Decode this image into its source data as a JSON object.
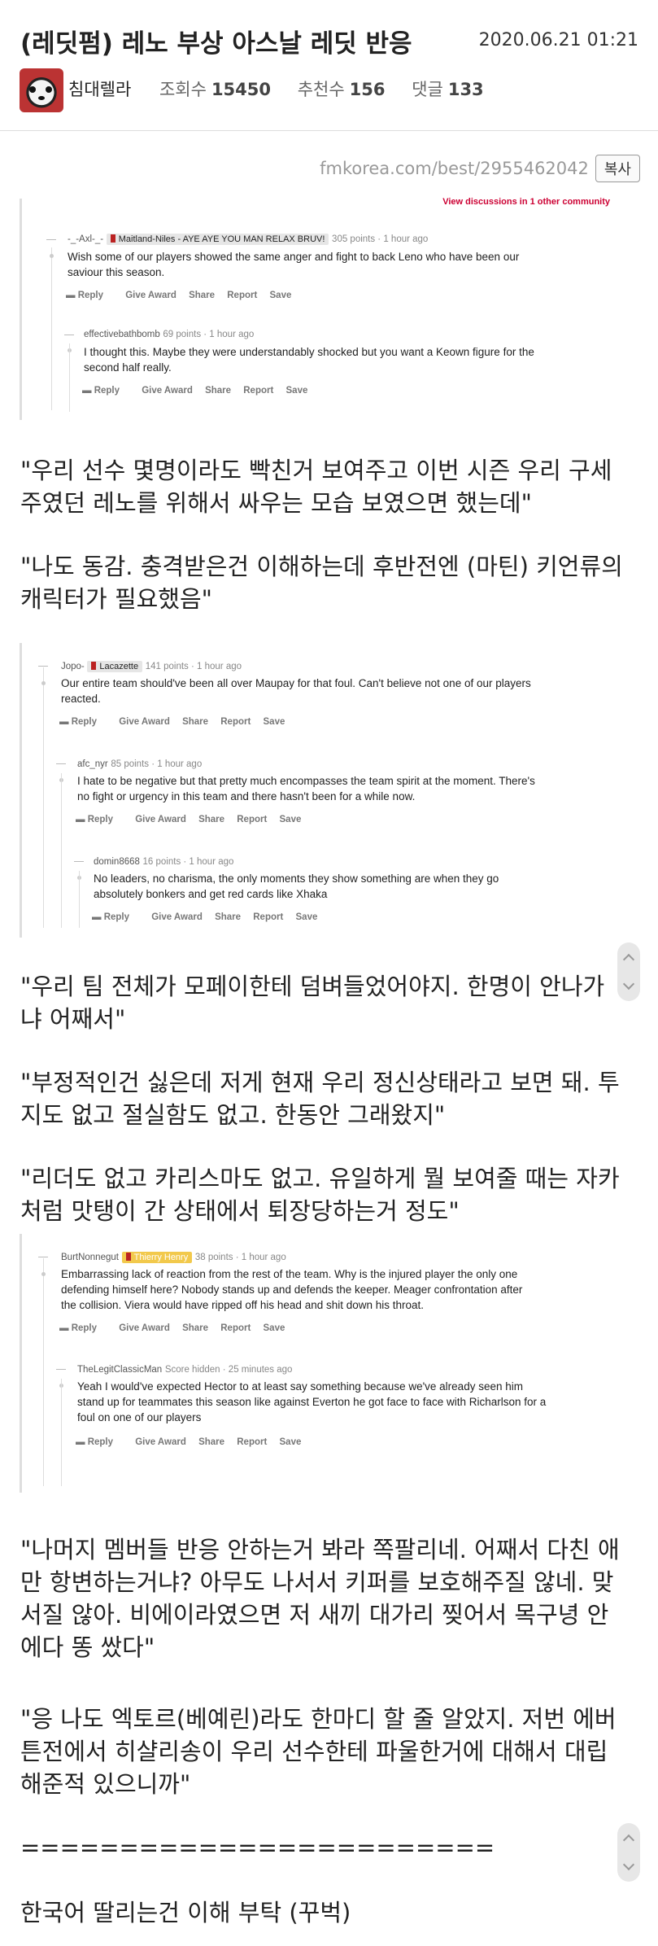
{
  "header": {
    "title": "(레딧펌) 레노 부상 아스날 레딧 반응",
    "date": "2020.06.21 01:21",
    "author": "침대렐라",
    "views_label": "조회수",
    "views": "15450",
    "likes_label": "추천수",
    "likes": "156",
    "comments_label": "댓글",
    "comments": "133"
  },
  "urlbar": {
    "url": "fmkorea.com/best/2955462042",
    "copy_label": "복사"
  },
  "shots": [
    {
      "top_cut": "View discussions in 1 other community",
      "comments": [
        {
          "user": "-_-Axl-_-",
          "flair": "Maitland-Niles - AYE AYE YOU MAN RELAX BRUV!",
          "points": "305 points · 1 hour ago",
          "lines": [
            "Wish some of our players showed the same anger and fight to back Leno who have been our",
            "saviour this season."
          ]
        },
        {
          "user": "effectivebathbomb",
          "flair": "",
          "points": "69 points · 1 hour ago",
          "lines": [
            "I thought this. Maybe they were understandably shocked but you want a Keown figure for the",
            "second half really."
          ]
        }
      ]
    },
    {
      "comments": [
        {
          "user": "Jopo-",
          "flair": "Lacazette",
          "points": "141 points · 1 hour ago",
          "lines": [
            "Our entire team should've been all over Maupay for that foul. Can't believe not one of our players",
            "reacted."
          ]
        },
        {
          "user": "afc_nyr",
          "flair": "",
          "points": "85 points · 1 hour ago",
          "lines": [
            "I hate to be negative but that pretty much encompasses the team spirit at the moment. There's",
            "no fight or urgency in this team and there hasn't been for a while now."
          ]
        },
        {
          "user": "domin8668",
          "flair": "",
          "points": "16 points · 1 hour ago",
          "lines": [
            "No leaders, no charisma, the only moments they show something are when they go",
            "absolutely bonkers and get red cards like Xhaka"
          ]
        }
      ]
    },
    {
      "comments": [
        {
          "user": "BurtNonnegut",
          "flair": "Thierry Henry",
          "points": "38 points · 1 hour ago",
          "lines": [
            "Embarrassing lack of reaction from the rest of the team. Why is the injured player the only one",
            "defending himself here? Nobody stands up and defends the keeper. Meager confrontation after",
            "the collision. Viera would have ripped off his head and shit down his throat."
          ]
        },
        {
          "user": "TheLegitClassicMan",
          "flair": "",
          "points": "Score hidden · 25 minutes ago",
          "lines": [
            "Yeah I would've expected Hector to at least say something because we've already seen him",
            "stand up for teammates this season like against Everton he got face to face with Richarlson for a",
            "foul on one of our players"
          ]
        }
      ]
    }
  ],
  "actions": [
    "Reply",
    "Give Award",
    "Share",
    "Report",
    "Save"
  ],
  "paragraphs": [
    [
      "\"우리 선수 몇명이라도 빡친거 보여주고 이번 시즌 우리 구세",
      "주였던 레노를 위해서 싸우는 모습 보였으면 했는데\""
    ],
    [
      "\"나도 동감. 충격받은건 이해하는데 후반전엔 (마틴) 키언류의",
      "캐릭터가 필요했음\""
    ],
    [
      "\"우리 팀 전체가 모페이한테 덤벼들었어야지. 한명이 안나가",
      "냐 어째서\""
    ],
    [
      "\"부정적인건 싫은데 저게 현재 우리 정신상태라고 보면 돼. 투",
      "지도 없고 절실함도 없고. 한동안 그래왔지\""
    ],
    [
      "\"리더도 없고 카리스마도 없고. 유일하게 뭘 보여줄 때는 자카",
      "처럼 맛탱이 간 상태에서 퇴장당하는거 정도\""
    ],
    [
      "\"나머지 멤버들 반응 안하는거 봐라 쪽팔리네. 어째서 다친 애",
      "만 항변하는거냐? 아무도 나서서 키퍼를 보호해주질 않네. 맞",
      "서질 않아. 비에이라였으면 저 새끼 대가리 찢어서 목구녕 안",
      "에다 똥 쌌다\""
    ],
    [
      "\"응 나도 엑토르(베예린)라도 한마디 할 줄 알았지. 저번 에버",
      "튼전에서 히샬리송이 우리 선수한테 파울한거에 대해서 대립",
      "해준적 있으니까\""
    ],
    [
      "========================"
    ],
    [
      "한국어 딸리는건 이해 부탁 (꾸벅)"
    ]
  ]
}
